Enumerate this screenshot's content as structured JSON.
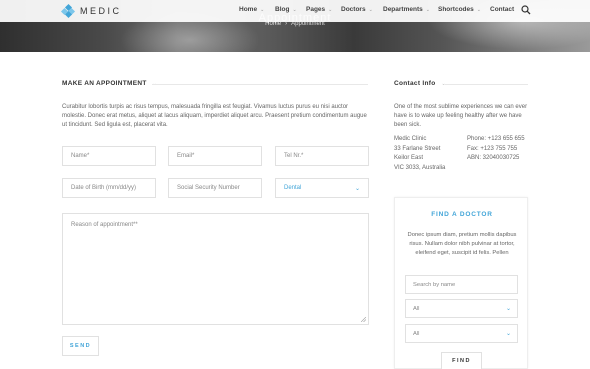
{
  "brand": {
    "name": "MEDIC",
    "accent_color": "#42a5d8"
  },
  "nav": {
    "items": [
      {
        "label": "Home",
        "has_dropdown": true
      },
      {
        "label": "Blog",
        "has_dropdown": true
      },
      {
        "label": "Pages",
        "has_dropdown": true
      },
      {
        "label": "Doctors",
        "has_dropdown": true
      },
      {
        "label": "Departments",
        "has_dropdown": true
      },
      {
        "label": "Shortcodes",
        "has_dropdown": true
      },
      {
        "label": "Contact",
        "has_dropdown": false
      }
    ],
    "search_icon": "search-icon"
  },
  "hero": {
    "title": "Appointment",
    "breadcrumb": [
      "Home",
      "Appointment"
    ]
  },
  "appointment": {
    "heading": "MAKE AN APPOINTMENT",
    "intro": "Curabitur lobortis turpis ac risus tempus, malesuada fringilla est feugiat. Vivamus luctus purus eu nisi auctor molestie. Donec erat metus, aliquet at lacus aliquam, imperdiet aliquet arcu. Praesent pretium condimentum augue ut tincidunt. Sed ligula est, placerat vita.",
    "fields": {
      "name": "Name*",
      "email": "Email*",
      "tel": "Tel Nr.*",
      "dob": "Date of Birth (mm/dd/yy)",
      "ssn": "Social Security Number",
      "department": "Dental",
      "reason": "Reason of appointment**"
    },
    "send_label": "SEND"
  },
  "contact": {
    "heading": "Contact Info",
    "intro": "One of the most sublime experiences we can ever have is to wake up feeling healthy after we have been sick.",
    "address": [
      "Medic Clinic",
      "33 Farlane Street",
      "Keilor East",
      "VIC 3033, Australia"
    ],
    "phones": [
      "Phone: +123 655 655",
      "Fax: +123 755 755",
      "ABN: 32040030725"
    ]
  },
  "find_doctor": {
    "title": "FIND A DOCTOR",
    "text": "Donec ipsum diam, pretium mollis dapibus risus. Nullam dolor nibh pulvinar at tortor, eleifend eget, suscipit id felis. Pellen",
    "search_placeholder": "Search by name",
    "select_1": "All",
    "select_2": "All",
    "button_label": "FIND"
  }
}
